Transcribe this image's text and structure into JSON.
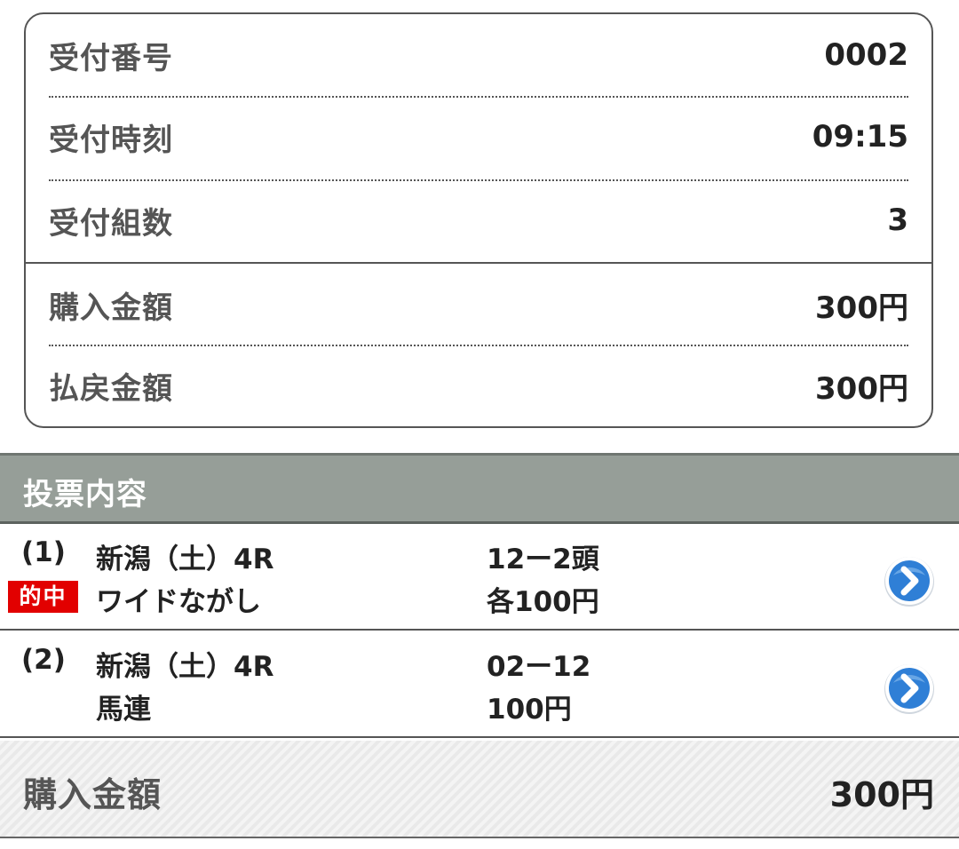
{
  "summary": {
    "rows": [
      {
        "label": "受付番号",
        "value": "0002"
      },
      {
        "label": "受付時刻",
        "value": "09:15"
      },
      {
        "label": "受付組数",
        "value": "3"
      },
      {
        "label": "購入金額",
        "value": "300円"
      },
      {
        "label": "払戻金額",
        "value": "300円"
      }
    ]
  },
  "bets_section": {
    "title": "投票内容",
    "items": [
      {
        "number": "(1)",
        "race": "新潟（土）4R",
        "bet_type": "ワイドながし",
        "combination": "12ー2頭",
        "amount": "各100円",
        "hit_badge": "的中",
        "detail_icon": "chevron-right-circle-icon"
      },
      {
        "number": "(2)",
        "race": "新潟（土）4R",
        "bet_type": "馬連",
        "combination": "02ー12",
        "amount": "100円",
        "hit_badge": null,
        "detail_icon": "chevron-right-circle-icon"
      }
    ]
  },
  "total": {
    "label": "購入金額",
    "value": "300円"
  },
  "colors": {
    "hit_badge": "#e20000",
    "section_header": "#969e98",
    "icon_blue": "#2f7fd6"
  }
}
